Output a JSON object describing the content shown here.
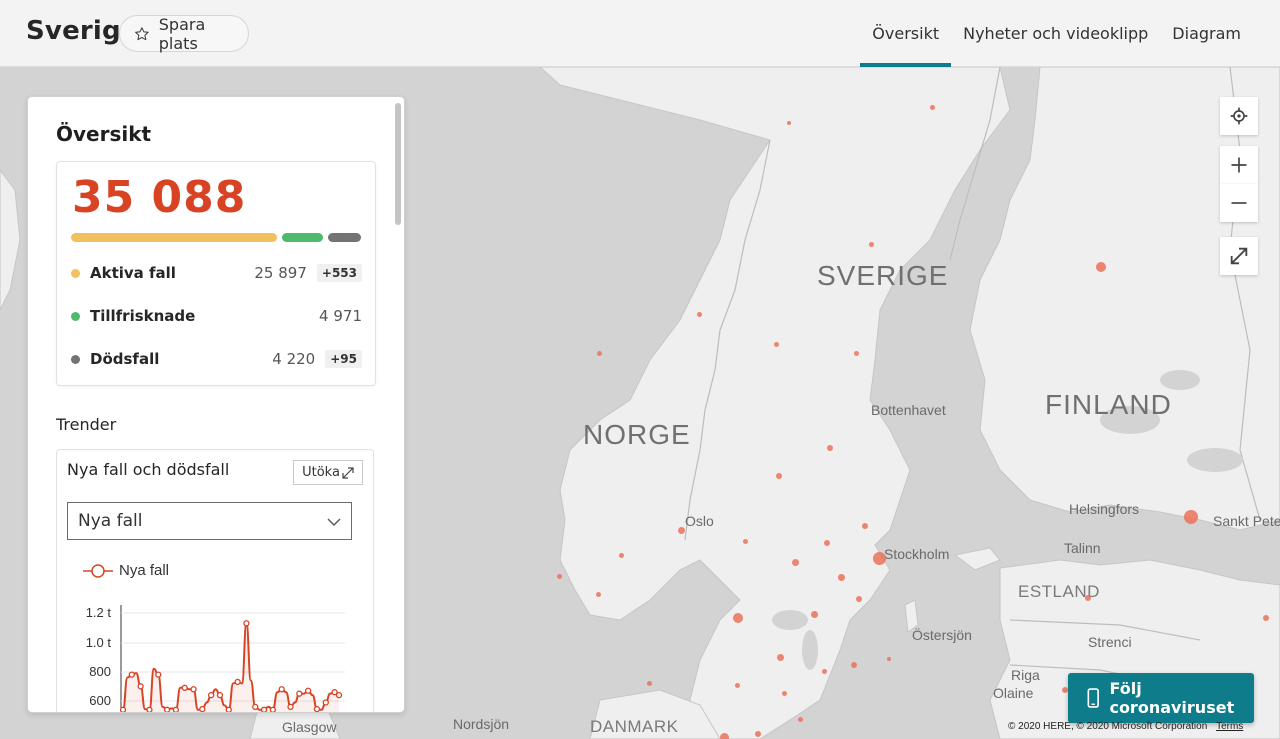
{
  "header": {
    "country": "Sverige",
    "save_label": "Spara plats",
    "tabs": [
      {
        "label": "Översikt",
        "active": true
      },
      {
        "label": "Nyheter och videoklipp",
        "active": false
      },
      {
        "label": "Diagram",
        "active": false
      }
    ]
  },
  "overview": {
    "title": "Översikt",
    "total": "35 088",
    "stats": [
      {
        "label": "Aktiva fall",
        "value": "25 897",
        "delta": "+553",
        "color": "#f0c15c"
      },
      {
        "label": "Tillfrisknade",
        "value": "4 971",
        "delta": "",
        "color": "#4cbb6c"
      },
      {
        "label": "Dödsfall",
        "value": "4 220",
        "delta": "+95",
        "color": "#737373"
      }
    ],
    "bar_shares": [
      25897,
      4971,
      4220
    ]
  },
  "trends": {
    "title": "Trender",
    "card_title": "Nya fall och dödsfall",
    "expand_label": "Utöka",
    "select_value": "Nya fall",
    "legend_label": "Nya fall"
  },
  "chart_data": {
    "type": "line",
    "series": [
      {
        "name": "Nya fall",
        "color": "#d84324",
        "values": [
          540,
          760,
          780,
          790,
          700,
          545,
          540,
          820,
          780,
          560,
          540,
          550,
          540,
          690,
          690,
          680,
          680,
          540,
          545,
          590,
          640,
          680,
          640,
          570,
          540,
          720,
          730,
          720,
          1130,
          740,
          560,
          540,
          540,
          560,
          540,
          660,
          680,
          660,
          560,
          590,
          650,
          650,
          670,
          640,
          545,
          540,
          590,
          650,
          660,
          640
        ]
      }
    ],
    "y_ticks": [
      "1.2 t",
      "1.0 t",
      "800",
      "600"
    ],
    "y_tick_values": [
      1200,
      1000,
      800,
      600
    ],
    "ylim": [
      500,
      1200
    ],
    "grid": true
  },
  "map": {
    "labels": {
      "sverige": "SVERIGE",
      "norge": "NORGE",
      "finland": "FINLAND",
      "estland": "ESTLAND",
      "danmark": "DANMARK",
      "bottenhavet": "Bottenhavet",
      "helsingfors": "Helsingfors",
      "sankt": "Sankt Peter",
      "oslo": "Oslo",
      "stockholm": "Stockholm",
      "tallinn": "Talinn",
      "ostersjon": "Östersjön",
      "strenci": "Strenci",
      "riga": "Riga",
      "olaine": "Olaine",
      "glasgow": "Glasgow",
      "nordsjon": "Nordsjön"
    },
    "follow_label": "Följ coronaviruset",
    "copyright": "© 2020 HERE, © 2020 Microsoft Corporation",
    "terms": "Terms"
  }
}
